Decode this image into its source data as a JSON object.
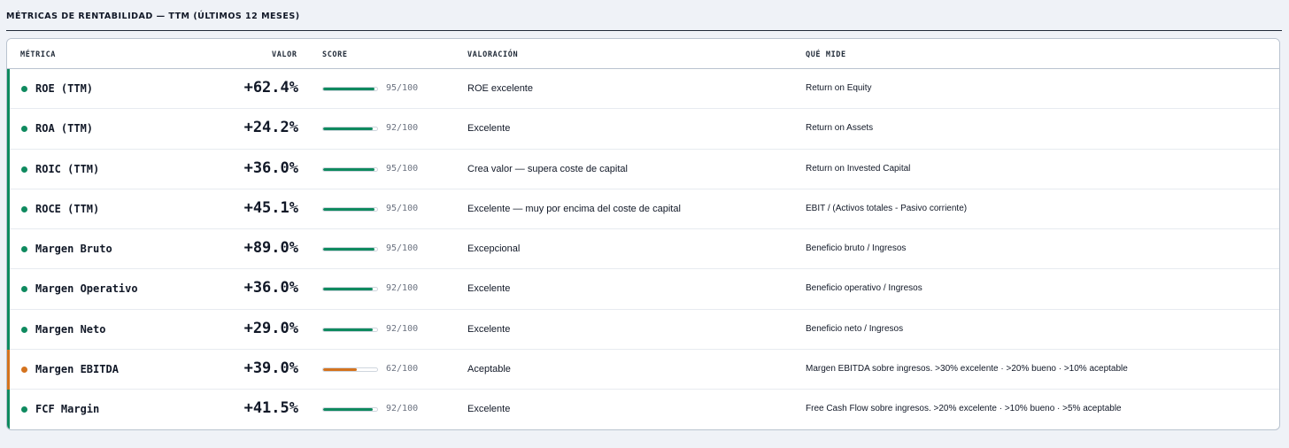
{
  "section": {
    "title": "MÉTRICAS DE RENTABILIDAD — TTM (ÚLTIMOS 12 MESES)"
  },
  "table": {
    "headers": {
      "metrica": "MÉTRICA",
      "valor": "VALOR",
      "score": "SCORE",
      "valoracion": "VALORACIÓN",
      "que_mide": "QUÉ MIDE"
    },
    "rows": [
      {
        "metric": "ROE (TTM)",
        "value": "+62.4%",
        "score": 95,
        "score_label": "95/100",
        "status": "good",
        "valoracion": "ROE excelente",
        "que_mide": "Return on Equity"
      },
      {
        "metric": "ROA (TTM)",
        "value": "+24.2%",
        "score": 92,
        "score_label": "92/100",
        "status": "good",
        "valoracion": "Excelente",
        "que_mide": "Return on Assets"
      },
      {
        "metric": "ROIC (TTM)",
        "value": "+36.0%",
        "score": 95,
        "score_label": "95/100",
        "status": "good",
        "valoracion": "Crea valor — supera coste de capital",
        "que_mide": "Return on Invested Capital"
      },
      {
        "metric": "ROCE (TTM)",
        "value": "+45.1%",
        "score": 95,
        "score_label": "95/100",
        "status": "good",
        "valoracion": "Excelente — muy por encima del coste de capital",
        "que_mide": "EBIT / (Activos totales - Pasivo corriente)"
      },
      {
        "metric": "Margen Bruto",
        "value": "+89.0%",
        "score": 95,
        "score_label": "95/100",
        "status": "good",
        "valoracion": "Excepcional",
        "que_mide": "Beneficio bruto / Ingresos"
      },
      {
        "metric": "Margen Operativo",
        "value": "+36.0%",
        "score": 92,
        "score_label": "92/100",
        "status": "good",
        "valoracion": "Excelente",
        "que_mide": "Beneficio operativo / Ingresos"
      },
      {
        "metric": "Margen Neto",
        "value": "+29.0%",
        "score": 92,
        "score_label": "92/100",
        "status": "good",
        "valoracion": "Excelente",
        "que_mide": "Beneficio neto / Ingresos"
      },
      {
        "metric": "Margen EBITDA",
        "value": "+39.0%",
        "score": 62,
        "score_label": "62/100",
        "status": "ok",
        "valoracion": "Aceptable",
        "que_mide": "Margen EBITDA sobre ingresos. >30% excelente · >20% bueno · >10% aceptable"
      },
      {
        "metric": "FCF Margin",
        "value": "+41.5%",
        "score": 92,
        "score_label": "92/100",
        "status": "good",
        "valoracion": "Excelente",
        "que_mide": "Free Cash Flow sobre ingresos. >20% excelente · >10% bueno · >5% aceptable"
      }
    ]
  },
  "colors": {
    "good": "#0f8a5f",
    "ok": "#d4731e"
  }
}
